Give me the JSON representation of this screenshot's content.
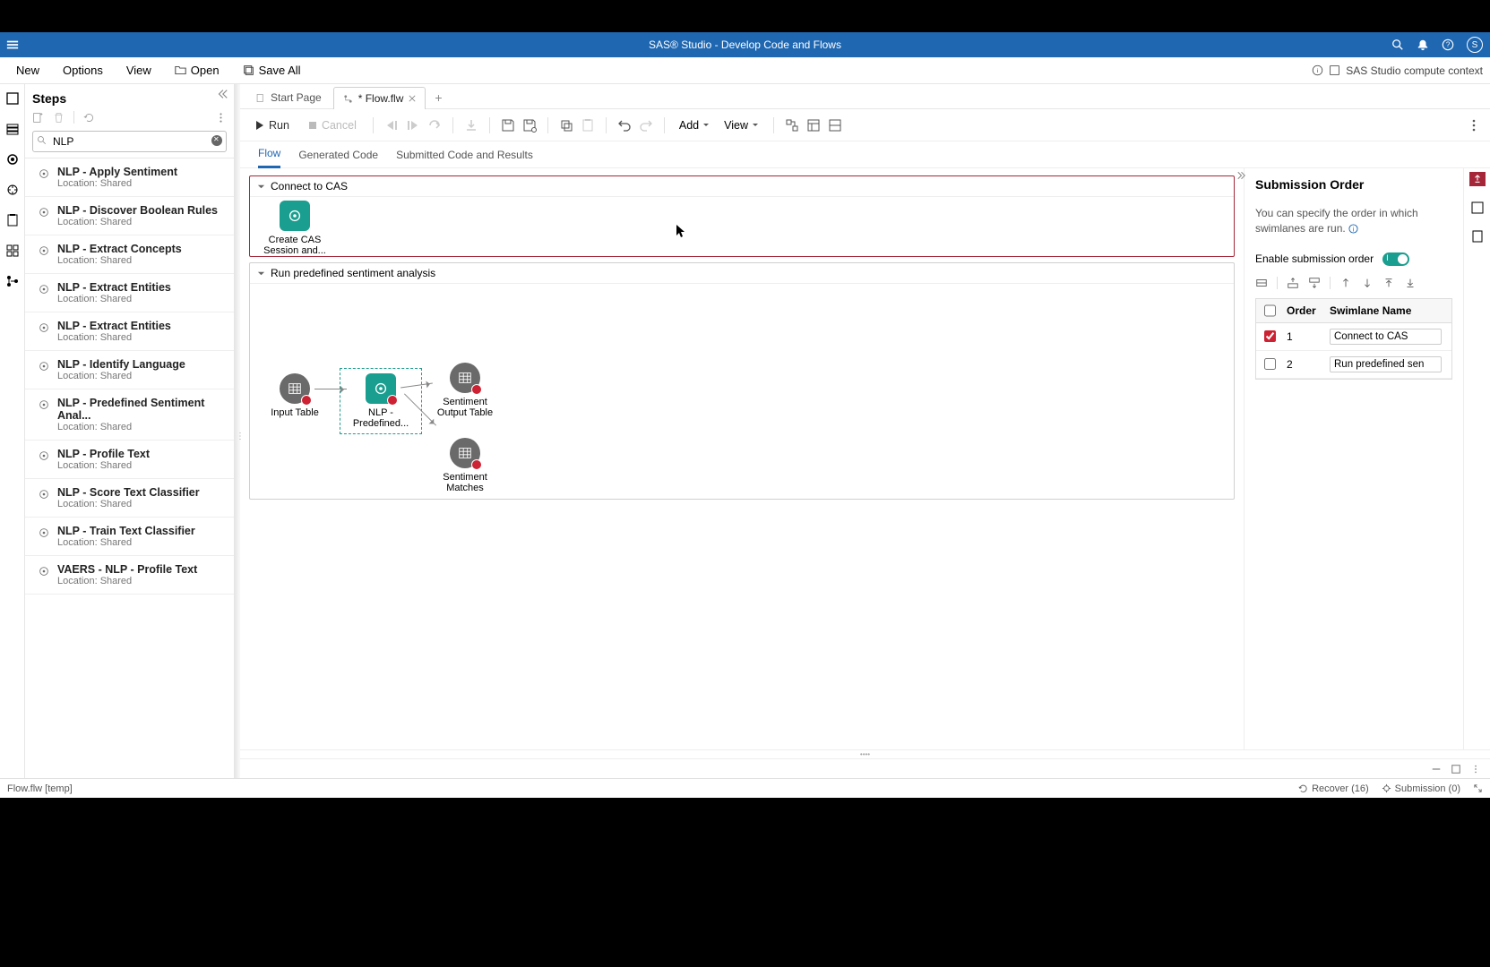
{
  "app_title": "SAS® Studio - Develop Code and Flows",
  "avatar_letter": "S",
  "menubar": {
    "new": "New",
    "options": "Options",
    "view": "View",
    "open": "Open",
    "save_all": "Save All",
    "context": "SAS Studio compute context"
  },
  "steps_panel": {
    "title": "Steps",
    "search_value": "NLP",
    "items": [
      {
        "name": "NLP - Apply Sentiment",
        "loc": "Location: Shared"
      },
      {
        "name": "NLP - Discover Boolean Rules",
        "loc": "Location: Shared"
      },
      {
        "name": "NLP - Extract Concepts",
        "loc": "Location: Shared"
      },
      {
        "name": "NLP - Extract Entities",
        "loc": "Location: Shared"
      },
      {
        "name": "NLP - Extract Entities",
        "loc": "Location: Shared"
      },
      {
        "name": "NLP - Identify Language",
        "loc": "Location: Shared"
      },
      {
        "name": "NLP - Predefined Sentiment Anal...",
        "loc": "Location: Shared"
      },
      {
        "name": "NLP - Profile Text",
        "loc": "Location: Shared"
      },
      {
        "name": "NLP - Score Text Classifier",
        "loc": "Location: Shared"
      },
      {
        "name": "NLP - Train Text Classifier",
        "loc": "Location: Shared"
      },
      {
        "name": "VAERS - NLP - Profile Text",
        "loc": "Location: Shared"
      }
    ]
  },
  "tabs": {
    "start": "Start Page",
    "flow": "* Flow.flw"
  },
  "toolbar": {
    "run": "Run",
    "cancel": "Cancel",
    "add": "Add",
    "view": "View"
  },
  "subtabs": {
    "flow": "Flow",
    "gen": "Generated Code",
    "sub": "Submitted Code and Results"
  },
  "swimlanes": {
    "s1_title": "Connect to CAS",
    "s2_title": "Run predefined sentiment analysis",
    "node_create": "Create CAS Session and...",
    "node_input": "Input Table",
    "node_nlp": "NLP - Predefined...",
    "node_out": "Sentiment Output Table",
    "node_match": "Sentiment Matches"
  },
  "prop": {
    "title": "Submission Order",
    "desc": "You can specify the order in which swimlanes are run.",
    "enable": "Enable submission order",
    "th_order": "Order",
    "th_name": "Swimlane Name",
    "rows": [
      {
        "checked": true,
        "order": "1",
        "name": "Connect to CAS"
      },
      {
        "checked": false,
        "order": "2",
        "name": "Run predefined sen"
      }
    ]
  },
  "status": {
    "path": "Flow.flw [temp]",
    "recover": "Recover (16)",
    "submission": "Submission (0)"
  }
}
